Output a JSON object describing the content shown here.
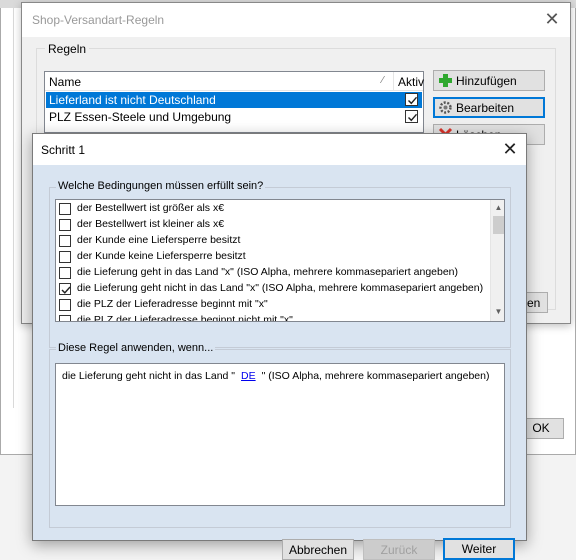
{
  "rules_dialog": {
    "title": "Shop-Versandart-Regeln",
    "close_symbol": "✕",
    "group_label": "Regeln",
    "columns": {
      "name": "Name",
      "active": "Aktiv"
    },
    "rows": [
      {
        "name": "Lieferland ist nicht Deutschland",
        "active": true,
        "selected": true
      },
      {
        "name": "PLZ Essen-Steele und Umgebung",
        "active": true,
        "selected": false
      }
    ],
    "add_label": "Hinzufügen",
    "edit_label": "Bearbeiten",
    "delete_label": "Löschen",
    "close_partial_label": "en"
  },
  "main_window": {
    "ok_label": "OK"
  },
  "step_dialog": {
    "title": "Schritt 1",
    "close_symbol": "✕",
    "conditions_group_label": "Welche Bedingungen müssen erfüllt sein?",
    "conditions": [
      {
        "text": "der Bestellwert ist größer als x€",
        "checked": false
      },
      {
        "text": "der Bestellwert ist kleiner als x€",
        "checked": false
      },
      {
        "text": "der Kunde eine Liefersperre besitzt",
        "checked": false
      },
      {
        "text": "der Kunde keine Liefersperre besitzt",
        "checked": false
      },
      {
        "text": "die Lieferung geht in das Land \"x\" (ISO Alpha, mehrere kommasepariert angeben)",
        "checked": false
      },
      {
        "text": "die Lieferung geht nicht in das Land \"x\" (ISO Alpha, mehrere kommasepariert angeben)",
        "checked": true
      },
      {
        "text": "die PLZ der Lieferadresse beginnt mit \"x\"",
        "checked": false
      },
      {
        "text": "die PLZ der Lieferadresse beginnt nicht mit \"x\"",
        "checked": false
      }
    ],
    "apply_group_label": "Diese Regel anwenden, wenn...",
    "rule_preview": {
      "before": "die Lieferung geht nicht in das Land \"",
      "link": "DE",
      "after": "\" (ISO Alpha, mehrere kommasepariert angeben)"
    },
    "cancel_label": "Abbrechen",
    "back_label": "Zurück",
    "next_label": "Weiter"
  },
  "icons": {
    "add": "plus-icon",
    "edit": "gear-icon",
    "delete": "cross-icon"
  },
  "colors": {
    "selection": "#0078d7",
    "dialog_body": "#d9e4f1",
    "link": "#0000ee"
  }
}
